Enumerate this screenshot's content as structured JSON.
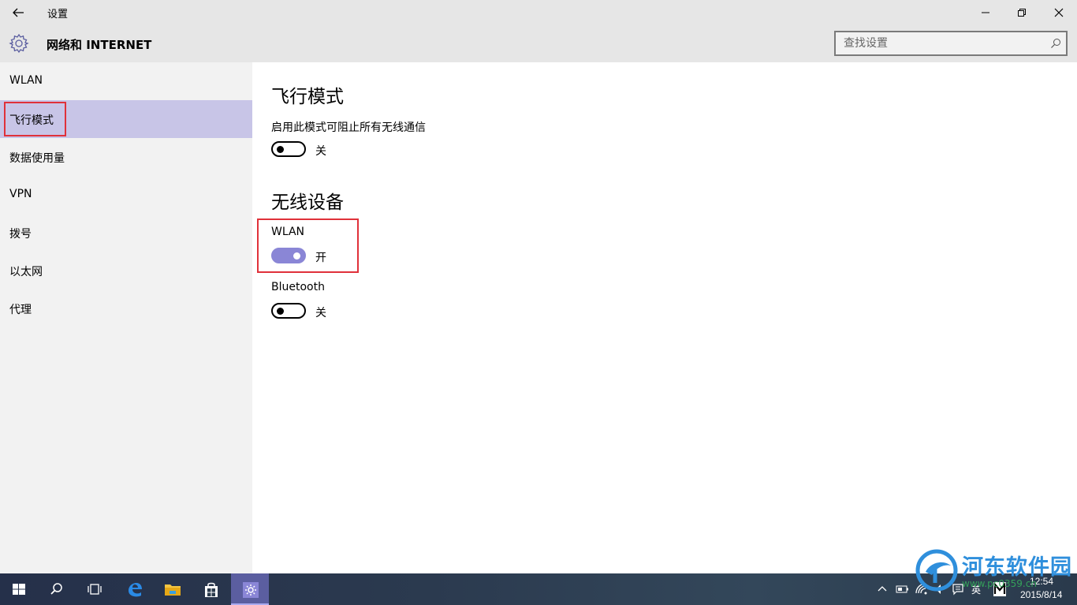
{
  "window": {
    "title": "设置",
    "back_icon": "back-arrow-icon",
    "controls": [
      "minimize-icon",
      "maximize-icon",
      "close-icon"
    ]
  },
  "header": {
    "title": "网络和 INTERNET",
    "icon": "gear-icon",
    "search_placeholder": "查找设置"
  },
  "sidebar": {
    "items": [
      {
        "label": "WLAN"
      },
      {
        "label": "飞行模式",
        "selected": true
      },
      {
        "label": "数据使用量"
      },
      {
        "label": "VPN"
      },
      {
        "label": "拨号"
      },
      {
        "label": "以太网"
      },
      {
        "label": "代理"
      }
    ]
  },
  "main": {
    "airplane": {
      "heading": "飞行模式",
      "description": "启用此模式可阻止所有无线通信",
      "toggle_state": "关",
      "on": false
    },
    "wireless": {
      "heading": "无线设备",
      "wlan": {
        "label": "WLAN",
        "toggle_state": "开",
        "on": true
      },
      "bluetooth": {
        "label": "Bluetooth",
        "toggle_state": "关",
        "on": false
      }
    }
  },
  "taskbar": {
    "items": [
      "windows-start-icon",
      "search-icon",
      "task-view-icon",
      "edge-icon",
      "file-explorer-icon",
      "store-icon",
      "settings-icon"
    ],
    "tray": {
      "ime": "英",
      "time": "12:54",
      "date": "2015/8/14"
    }
  },
  "watermark": {
    "text": "河东软件园",
    "url": "www.pc0359.cn"
  },
  "colors": {
    "accent": "#8a86d6",
    "selected": "#c8c5e7",
    "highlight_box": "#e0313a"
  }
}
